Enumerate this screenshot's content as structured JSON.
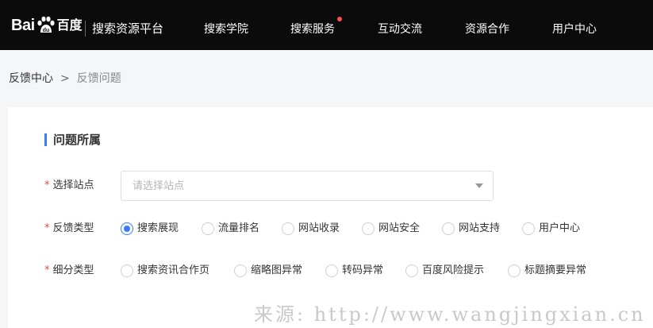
{
  "header": {
    "logo_text_latin": "Bai",
    "logo_text_cn": "百度",
    "platform_title": "搜索资源平台",
    "nav": [
      {
        "label": "搜索学院"
      },
      {
        "label": "搜索服务",
        "has_dot": true
      },
      {
        "label": "互动交流"
      },
      {
        "label": "资源合作"
      },
      {
        "label": "用户中心"
      }
    ]
  },
  "breadcrumb": {
    "root": "反馈中心",
    "separator": ">",
    "current": "反馈问题"
  },
  "form": {
    "section_title": "问题所属",
    "required_mark": "*",
    "site": {
      "label": "选择站点",
      "placeholder": "请选择站点"
    },
    "feedback_type": {
      "label": "反馈类型",
      "options": [
        "搜索展现",
        "流量排名",
        "网站收录",
        "网站安全",
        "网站支持",
        "用户中心"
      ],
      "selected": "搜索展现"
    },
    "sub_type": {
      "label": "细分类型",
      "options": [
        "搜索资讯合作页",
        "缩略图异常",
        "转码异常",
        "百度风险提示",
        "标题摘要异常"
      ],
      "selected": null
    }
  },
  "watermark": "来源: http://www.wangjingxian.cn",
  "colors": {
    "topbar_bg": "#0b0b0b",
    "accent_blue": "#3a7cf4",
    "required_red": "#e84b3c",
    "notification_dot": "#ff4d4f"
  },
  "icons": {
    "logo": "baidu-paw-icon",
    "select_arrow": "caret-down-icon"
  }
}
